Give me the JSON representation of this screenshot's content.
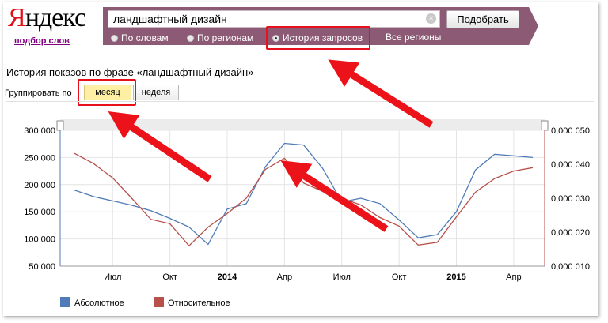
{
  "logo": {
    "first_letter": "Я",
    "rest": "ндекс"
  },
  "header": {
    "wordstat_link": "подбор слов"
  },
  "search": {
    "value": "ландшафтный дизайн",
    "submit_label": "Подобрать"
  },
  "modes": [
    {
      "label": "По словам",
      "selected": false
    },
    {
      "label": "По регионам",
      "selected": false
    },
    {
      "label": "История запросов",
      "selected": true
    }
  ],
  "regions_link": "Все регионы",
  "history": {
    "title": "История показов по фразе «ландшафтный дизайн»"
  },
  "grouping": {
    "label": "Группировать по",
    "month_label": "месяц",
    "week_label": "неделя",
    "selected": "месяц"
  },
  "colors": {
    "absolute": "#4f7bb6",
    "relative": "#b8504b",
    "header_bg": "#8d5a75",
    "highlight": "#e8101a"
  },
  "chart_data": {
    "type": "line",
    "x": [
      "2013-05",
      "2013-06",
      "2013-07",
      "2013-08",
      "2013-09",
      "2013-10",
      "2013-11",
      "2013-12",
      "2014-01",
      "2014-02",
      "2014-03",
      "2014-04",
      "2014-05",
      "2014-06",
      "2014-07",
      "2014-08",
      "2014-09",
      "2014-10",
      "2014-11",
      "2014-12",
      "2015-01",
      "2015-02",
      "2015-03",
      "2015-04",
      "2015-05"
    ],
    "tick_labels": [
      {
        "label": "Июл",
        "x": "2013-07",
        "bold": false
      },
      {
        "label": "Окт",
        "x": "2013-10",
        "bold": false
      },
      {
        "label": "2014",
        "x": "2014-01",
        "bold": true
      },
      {
        "label": "Апр",
        "x": "2014-04",
        "bold": false
      },
      {
        "label": "Июл",
        "x": "2014-07",
        "bold": false
      },
      {
        "label": "Окт",
        "x": "2014-10",
        "bold": false
      },
      {
        "label": "2015",
        "x": "2015-01",
        "bold": true
      },
      {
        "label": "Апр",
        "x": "2015-04",
        "bold": false
      }
    ],
    "y_left": {
      "ticks": [
        "300 000",
        "250 000",
        "200 000",
        "150 000",
        "100 000",
        "50 000"
      ],
      "range": [
        50000,
        300000
      ]
    },
    "y_right": {
      "ticks": [
        "0,000 050",
        "0,000 040",
        "0,000 030",
        "0,000 020",
        "0,000 010"
      ],
      "range": [
        1e-05,
        5e-05
      ]
    },
    "series": [
      {
        "name": "Абсолютное",
        "axis": "left",
        "values": [
          190000,
          178000,
          170000,
          162000,
          152000,
          138000,
          122000,
          90000,
          155000,
          165000,
          233000,
          276000,
          273000,
          230000,
          168000,
          175000,
          165000,
          135000,
          102000,
          108000,
          150000,
          227000,
          256000,
          253000,
          250000
        ]
      },
      {
        "name": "Относительное",
        "axis": "right",
        "values": [
          4.32e-05,
          4.02e-05,
          3.6e-05,
          3e-05,
          2.38e-05,
          2.25e-05,
          1.6e-05,
          2.15e-05,
          2.55e-05,
          3e-05,
          3.85e-05,
          4.18e-05,
          3.45e-05,
          3.2e-05,
          3e-05,
          2.8e-05,
          2.43e-05,
          2.18e-05,
          1.62e-05,
          1.7e-05,
          2.45e-05,
          3.18e-05,
          3.58e-05,
          3.8e-05,
          3.9e-05
        ]
      }
    ],
    "grid": true,
    "legend_position": "bottom-left"
  }
}
